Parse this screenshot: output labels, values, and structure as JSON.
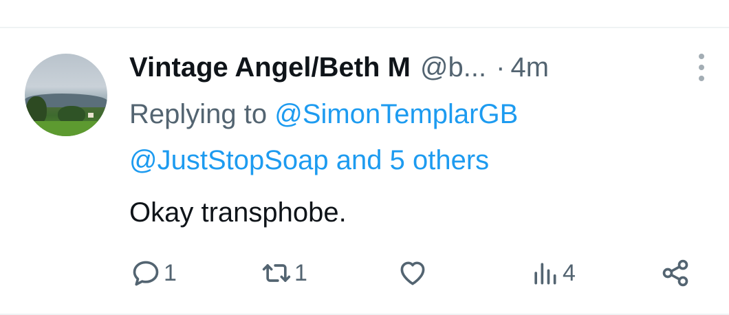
{
  "tweet": {
    "author_name": "Vintage Angel/Beth M",
    "author_handle": "@b...",
    "separator": "·",
    "time": "4m",
    "replying_prefix": "Replying to",
    "replying_user": "@SimonTemplarGB",
    "replying_more": "@JustStopSoap and 5 others",
    "text": "Okay transphobe."
  },
  "actions": {
    "replies": "1",
    "reposts": "1",
    "views": "4"
  },
  "icons": [
    "reply-icon",
    "repost-icon",
    "like-icon",
    "views-icon",
    "share-icon",
    "more-icon"
  ],
  "colors": {
    "link": "#1d9bf0",
    "secondary": "#536471",
    "text": "#0f1419"
  }
}
